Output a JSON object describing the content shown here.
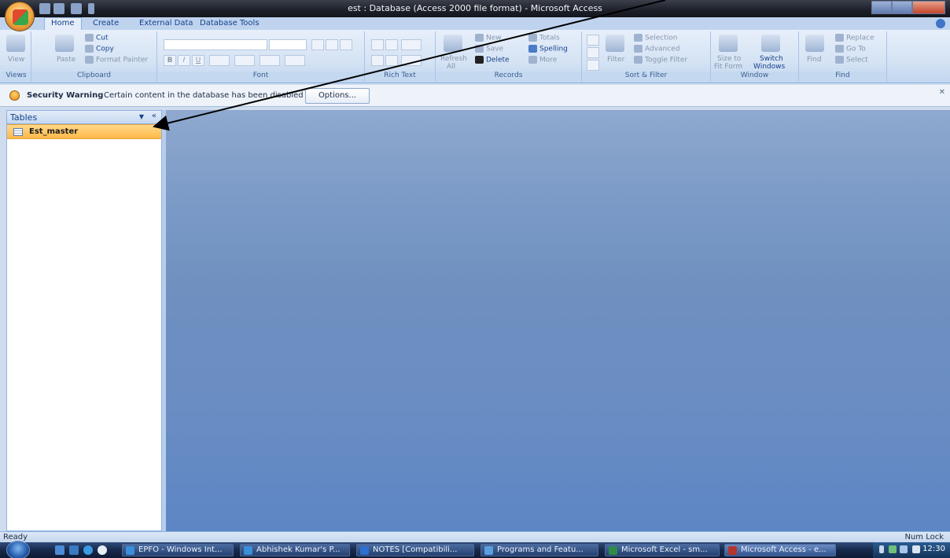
{
  "window": {
    "title": "est : Database (Access 2000 file format) - Microsoft Access"
  },
  "ribbon_tabs": [
    "Home",
    "Create",
    "External Data",
    "Database Tools"
  ],
  "ribbon": {
    "views": {
      "view": "View",
      "label": "Views"
    },
    "clipboard": {
      "paste": "Paste",
      "cut": "Cut",
      "copy": "Copy",
      "format_painter": "Format Painter",
      "label": "Clipboard"
    },
    "font": {
      "bold": "B",
      "italic": "I",
      "underline": "U",
      "label": "Font"
    },
    "rich_text": {
      "label": "Rich Text"
    },
    "records": {
      "refresh": "Refresh",
      "refresh_sub": "All",
      "new": "New",
      "save": "Save",
      "delete": "Delete",
      "totals": "Totals",
      "spelling": "Spelling",
      "more": "More",
      "label": "Records"
    },
    "sort_filter": {
      "filter": "Filter",
      "selection": "Selection",
      "advanced": "Advanced",
      "toggle_filter": "Toggle Filter",
      "label": "Sort & Filter"
    },
    "window": {
      "size_to": "Size to",
      "fit_form": "Fit Form",
      "switch": "Switch",
      "windows": "Windows",
      "label": "Window"
    },
    "find": {
      "find": "Find",
      "replace": "Replace",
      "go_to": "Go To",
      "select": "Select",
      "label": "Find"
    }
  },
  "security_bar": {
    "title": "Security Warning",
    "message": "Certain content in the database has been disabled",
    "options_label": "Options..."
  },
  "nav_pane": {
    "header": "Tables",
    "items": [
      {
        "label": "Est_master"
      }
    ]
  },
  "status_bar": {
    "left": "Ready",
    "right": "Num Lock"
  },
  "taskbar": {
    "buttons": [
      {
        "label": "EPFO - Windows Int...",
        "color": "#3a8fd8"
      },
      {
        "label": "Abhishek Kumar's P...",
        "color": "#3a8fd8"
      },
      {
        "label": "NOTES [Compatibili...",
        "color": "#2f6fd0"
      },
      {
        "label": "Programs and Featu...",
        "color": "#5a9fe0"
      },
      {
        "label": "Microsoft Excel - sm...",
        "color": "#2e8b4a"
      },
      {
        "label": "Microsoft Access - e...",
        "color": "#b8352b"
      }
    ],
    "clock": "12:30"
  }
}
